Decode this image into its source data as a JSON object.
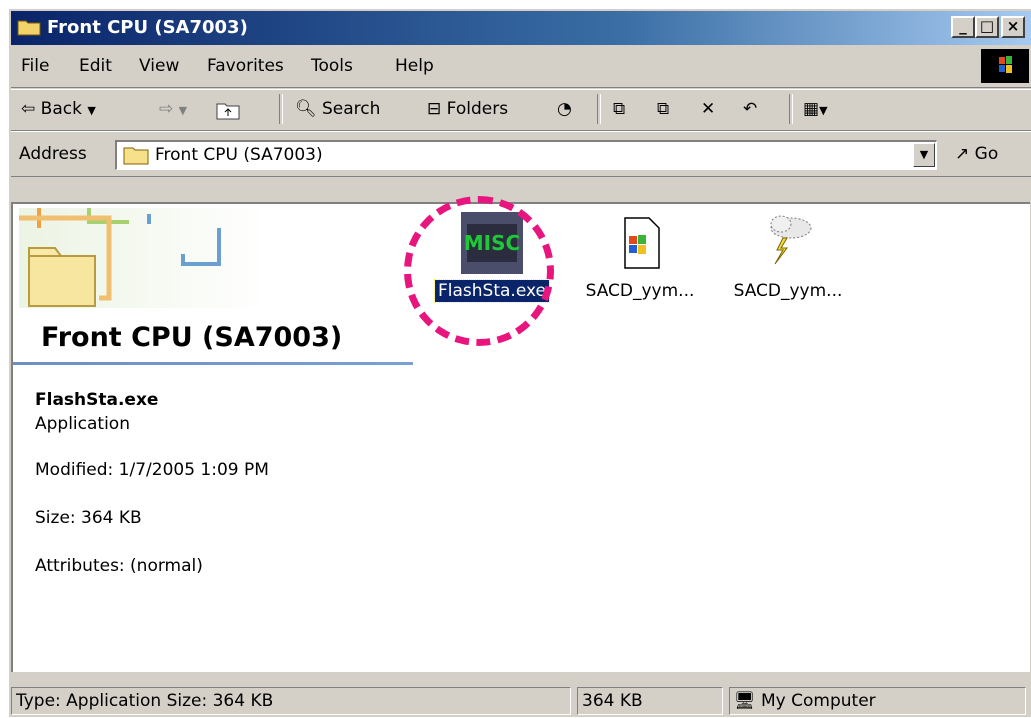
{
  "window": {
    "title": "Front CPU (SA7003)",
    "minimize": "_",
    "maximize": "□",
    "close": "×"
  },
  "menu": [
    {
      "label": "File"
    },
    {
      "label": "Edit"
    },
    {
      "label": "View"
    },
    {
      "label": "Favorites"
    },
    {
      "label": "Tools"
    },
    {
      "label": "Help"
    }
  ],
  "toolbar": {
    "back": "Back",
    "search": "Search",
    "folders": "Folders"
  },
  "address": {
    "label": "Address",
    "value": "Front CPU (SA7003)",
    "go": "Go"
  },
  "folder_pane": {
    "heading": "Front CPU (SA7003)",
    "selected_name": "FlashSta.exe",
    "selected_type": "Application",
    "modified": "Modified: 1/7/2005 1:09 PM",
    "size": "Size: 364 KB",
    "attributes": "Attributes: (normal)"
  },
  "files": [
    {
      "name": "FlashSta.exe",
      "icon": "misc-chip-icon",
      "selected": true
    },
    {
      "name": "SACD_yym...",
      "icon": "windows-doc-icon",
      "selected": false
    },
    {
      "name": "SACD_yym...",
      "icon": "cloud-lightning-icon",
      "selected": false
    }
  ],
  "statusbar": {
    "type_text": "Type: Application Size: 364 KB",
    "size": "364 KB",
    "zone": "My Computer"
  },
  "colors": {
    "highlight_circle": "#e8157f",
    "selection": "#0a246a",
    "title_gradient_start": "#0a246a"
  }
}
